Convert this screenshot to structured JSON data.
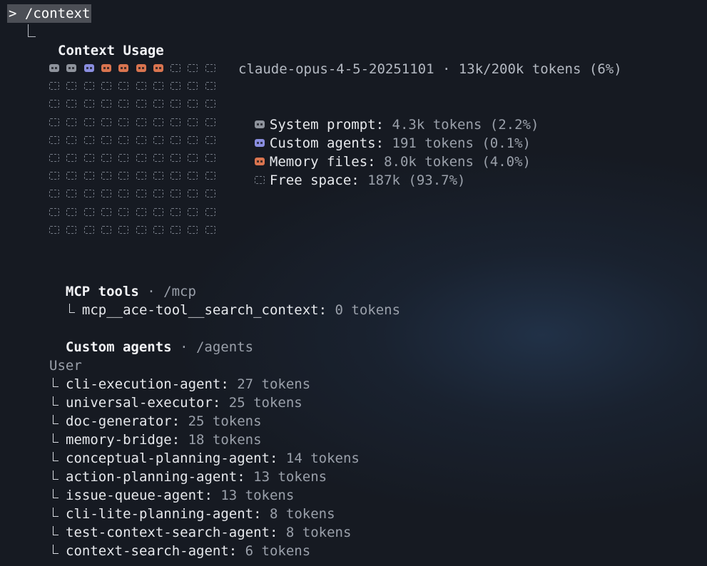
{
  "command": "> /context",
  "context": {
    "title": "Context Usage",
    "model_summary": "claude-opus-4-5-20251101 · 13k/200k tokens (6%)",
    "grid": {
      "columns": 10,
      "rows": 10,
      "cells": [
        "sys",
        "sys",
        "agent",
        "mem",
        "mem",
        "mem",
        "mem",
        "free",
        "free",
        "free"
      ],
      "colors": {
        "system_prompt": "#8e939c",
        "custom_agents": "#8a8ee0",
        "memory_files": "#d9744f",
        "free_space": "#767c87"
      }
    },
    "legend": [
      {
        "key": "System prompt:",
        "value": "4.3k tokens (2.2%)",
        "kind": "sys"
      },
      {
        "key": "Custom agents:",
        "value": "191 tokens (0.1%)",
        "kind": "agent"
      },
      {
        "key": "Memory files:",
        "value": "8.0k tokens (4.0%)",
        "kind": "mem"
      },
      {
        "key": "Free space:",
        "value": "187k (93.7%)",
        "kind": "free"
      }
    ]
  },
  "mcp": {
    "title": "MCP tools",
    "path": "· /mcp",
    "items": [
      {
        "name": "mcp__ace-tool__search_context:",
        "tokens": "0 tokens"
      }
    ]
  },
  "agents": {
    "title": "Custom agents",
    "path": "· /agents",
    "group": "User",
    "items": [
      {
        "name": "cli-execution-agent:",
        "tokens": "27 tokens"
      },
      {
        "name": "universal-executor:",
        "tokens": "25 tokens"
      },
      {
        "name": "doc-generator:",
        "tokens": "25 tokens"
      },
      {
        "name": "memory-bridge:",
        "tokens": "18 tokens"
      },
      {
        "name": "conceptual-planning-agent:",
        "tokens": "14 tokens"
      },
      {
        "name": "action-planning-agent:",
        "tokens": "13 tokens"
      },
      {
        "name": "issue-queue-agent:",
        "tokens": "13 tokens"
      },
      {
        "name": "cli-lite-planning-agent:",
        "tokens": "8 tokens"
      },
      {
        "name": "test-context-search-agent:",
        "tokens": "8 tokens"
      },
      {
        "name": "context-search-agent:",
        "tokens": "6 tokens"
      }
    ]
  }
}
